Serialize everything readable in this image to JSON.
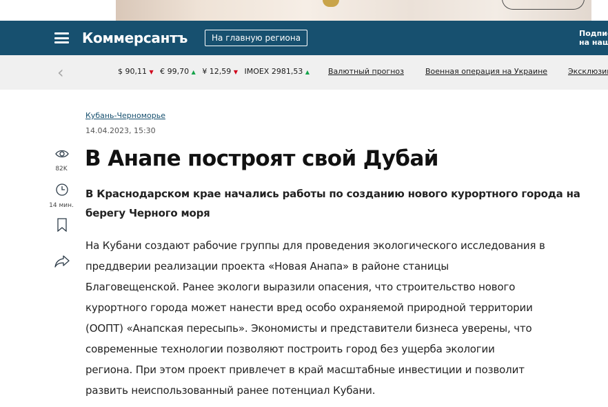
{
  "header": {
    "logo": "Коммерсантъ",
    "region_button": "На главную региона",
    "subscribe_line1": "Подпис",
    "subscribe_line2": "на наш",
    "brand_color": "#17506f"
  },
  "ticker": {
    "quotes": [
      {
        "label": "$ 90,11",
        "trend": "down"
      },
      {
        "label": "€ 99,70",
        "trend": "up"
      },
      {
        "label": "¥ 12,59",
        "trend": "down"
      },
      {
        "label": "IMOEX 2981,53",
        "trend": "up"
      }
    ],
    "links": [
      "Валютный прогноз",
      "Военная операция на Украине",
      "Эксклюзив"
    ],
    "colors": {
      "down": "#d0021b",
      "up": "#15a34a"
    }
  },
  "article": {
    "rubric": "Кубань-Черноморье",
    "date": "14.04.2023, 15:30",
    "views": "82K",
    "read_time": "14 мин.",
    "title": "В Анапе построят свой Дубай",
    "subtitle": "В Краснодарском крае начались работы по созданию нового курортного города на берегу Черного моря",
    "body_lines": [
      "На Кубани создают рабочие группы для проведения экологического исследования в",
      "преддверии реализации проекта «Новая Анапа» в районе станицы",
      "Благовещенской. Ранее экологи выразили опасения, что строительство нового",
      "курортного города может нанести вред особо охраняемой природной территории",
      "(ООПТ) «Анапская пересыпь». Экономисты и представители бизнеса уверены, что",
      "современные технологии позволяют построить город без ущерба экологии",
      "региона. При этом проект привлечет в край масштабные инвестиции и позволит",
      "развить неиспользованный ранее потенциал Кубани."
    ]
  },
  "icons": {
    "menu": "hamburger-menu-icon",
    "back": "chevron-left-icon",
    "views": "eye-icon",
    "time": "clock-icon",
    "bookmark": "bookmark-icon",
    "share": "share-arrow-icon"
  }
}
